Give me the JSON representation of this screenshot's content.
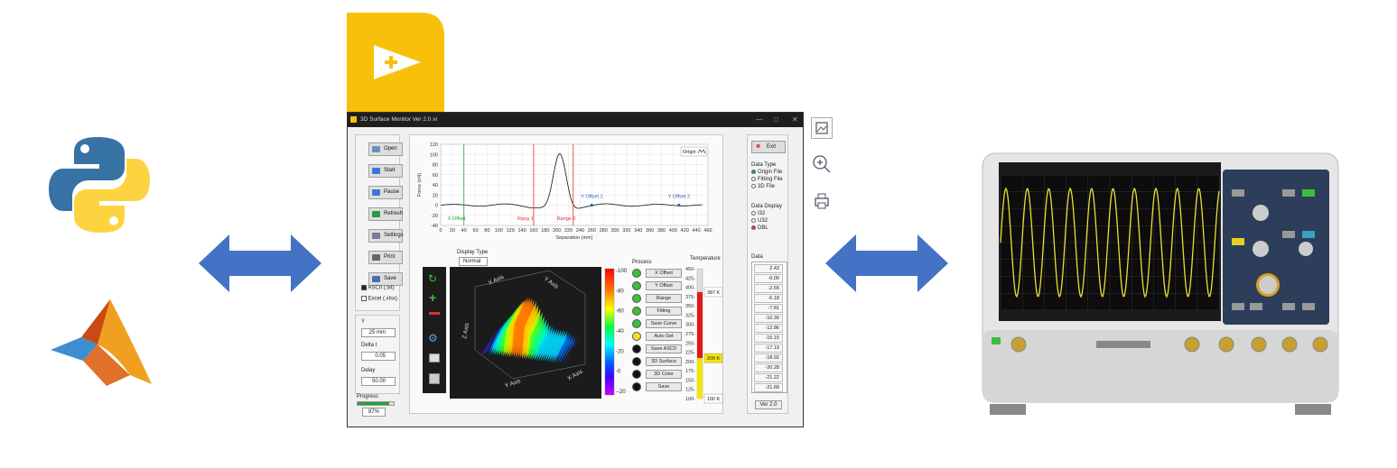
{
  "window": {
    "title": "3D Surface Monitor Ver 2.0.vi",
    "min": "—",
    "max": "□",
    "close": "✕"
  },
  "left_buttons": [
    {
      "label": "Open",
      "color": "#6a8fbf"
    },
    {
      "label": "Start",
      "color": "#3a78d6"
    },
    {
      "label": "Pause",
      "color": "#3a78d6"
    },
    {
      "label": "Refresh",
      "color": "#2e9a3e"
    },
    {
      "label": "Settings",
      "color": "#7a7a9a"
    },
    {
      "label": "Print",
      "color": "#666666"
    },
    {
      "label": "Save",
      "color": "#4a6fa5"
    }
  ],
  "save_options": [
    {
      "label": "ASCII (.txt)",
      "checked": true
    },
    {
      "label": "Excel (.xlsx)",
      "checked": false
    }
  ],
  "params": {
    "y_label": "Y",
    "y_value": "25 mm",
    "delta_label": "Delta t",
    "delta_value": "0.05",
    "delay_label": "Delay",
    "delay_value": "50.00",
    "progress_label": "Progress",
    "progress_value": "87%",
    "progress_fraction": 0.87
  },
  "chart_data": {
    "type": "line",
    "ylabel": "Force (nN)",
    "xlabel": "Separation (mm)",
    "legend": "Origin",
    "xlim": [
      0,
      460
    ],
    "ylim": [
      -40,
      120
    ],
    "x_ticks": [
      "0",
      "20",
      "40",
      "60",
      "80",
      "100",
      "120",
      "140",
      "160",
      "180",
      "200",
      "220",
      "240",
      "260",
      "280",
      "300",
      "320",
      "340",
      "360",
      "380",
      "400",
      "420",
      "440",
      "460"
    ],
    "y_ticks": [
      "120",
      "100",
      "80",
      "60",
      "40",
      "20",
      "0",
      "-20",
      "-40"
    ],
    "cursors": [
      {
        "label": "X Offset",
        "x": 40,
        "color": "#2a9a2a"
      },
      {
        "label": "Rang 1",
        "x": 160,
        "color": "#e03030"
      },
      {
        "label": "Range 2",
        "x": 228,
        "color": "#e03030"
      }
    ],
    "markers": [
      {
        "label": "Y Offset 1",
        "x": 260
      },
      {
        "label": "Y Offset 2",
        "x": 410
      }
    ]
  },
  "display_type": {
    "label": "Display Type",
    "value": "Normal"
  },
  "surface": {
    "x_axis": "X Axis",
    "y_axis": "Y Axis",
    "z_axis": "Z Axis",
    "colorbar_ticks": [
      "100",
      "80",
      "60",
      "40",
      "20",
      "0",
      "-20"
    ]
  },
  "process": {
    "label": "Process",
    "items": [
      {
        "label": "X Offset",
        "led": "#3cbf3c"
      },
      {
        "label": "Y Offset",
        "led": "#3cbf3c"
      },
      {
        "label": "Range",
        "led": "#3cbf3c"
      },
      {
        "label": "Fitting",
        "led": "#3cbf3c"
      },
      {
        "label": "Save Curve",
        "led": "#3cbf3c"
      },
      {
        "label": "Auto Set",
        "led": "#f2e02a"
      },
      {
        "label": "Save ASCII",
        "led": "#111111"
      },
      {
        "label": "3D Surface",
        "led": "#111111"
      },
      {
        "label": "3D Color",
        "led": "#111111"
      },
      {
        "label": "Save",
        "led": "#111111"
      }
    ]
  },
  "temperature": {
    "label": "Temperature",
    "ticks": [
      "450",
      "425",
      "400",
      "375",
      "350",
      "325",
      "300",
      "275",
      "250",
      "225",
      "200",
      "175",
      "150",
      "125",
      "100"
    ],
    "high_label": "387 K",
    "current_label": "209 K",
    "low_label": "100 K"
  },
  "right_panel": {
    "exit_label": "Exit",
    "data_type_label": "Data Type",
    "data_types": [
      {
        "label": "Origin File",
        "on": true
      },
      {
        "label": "Fitting File",
        "on": false
      },
      {
        "label": "3D File",
        "on": false
      }
    ],
    "data_display_label": "Data Display",
    "data_displays": [
      {
        "label": "I32",
        "on": false
      },
      {
        "label": "U32",
        "on": false
      },
      {
        "label": "DBL",
        "on": true
      }
    ],
    "data_label": "Data",
    "data_values": [
      "2.43",
      "-0.00",
      "-2.55",
      "-5.18",
      "-7.81",
      "-10.39",
      "-12.86",
      "-15.15",
      "-17.19",
      "-18.92",
      "-20.28",
      "-21.22",
      "-21.68"
    ],
    "version": "Ver 2.0"
  },
  "icons": {
    "python": "python-logo",
    "matlab": "matlab-logo",
    "labview": "labview-logo",
    "scope": "oscilloscope-image"
  },
  "colors": {
    "arrow": "#4472c4",
    "labview": "#f8c00a"
  }
}
